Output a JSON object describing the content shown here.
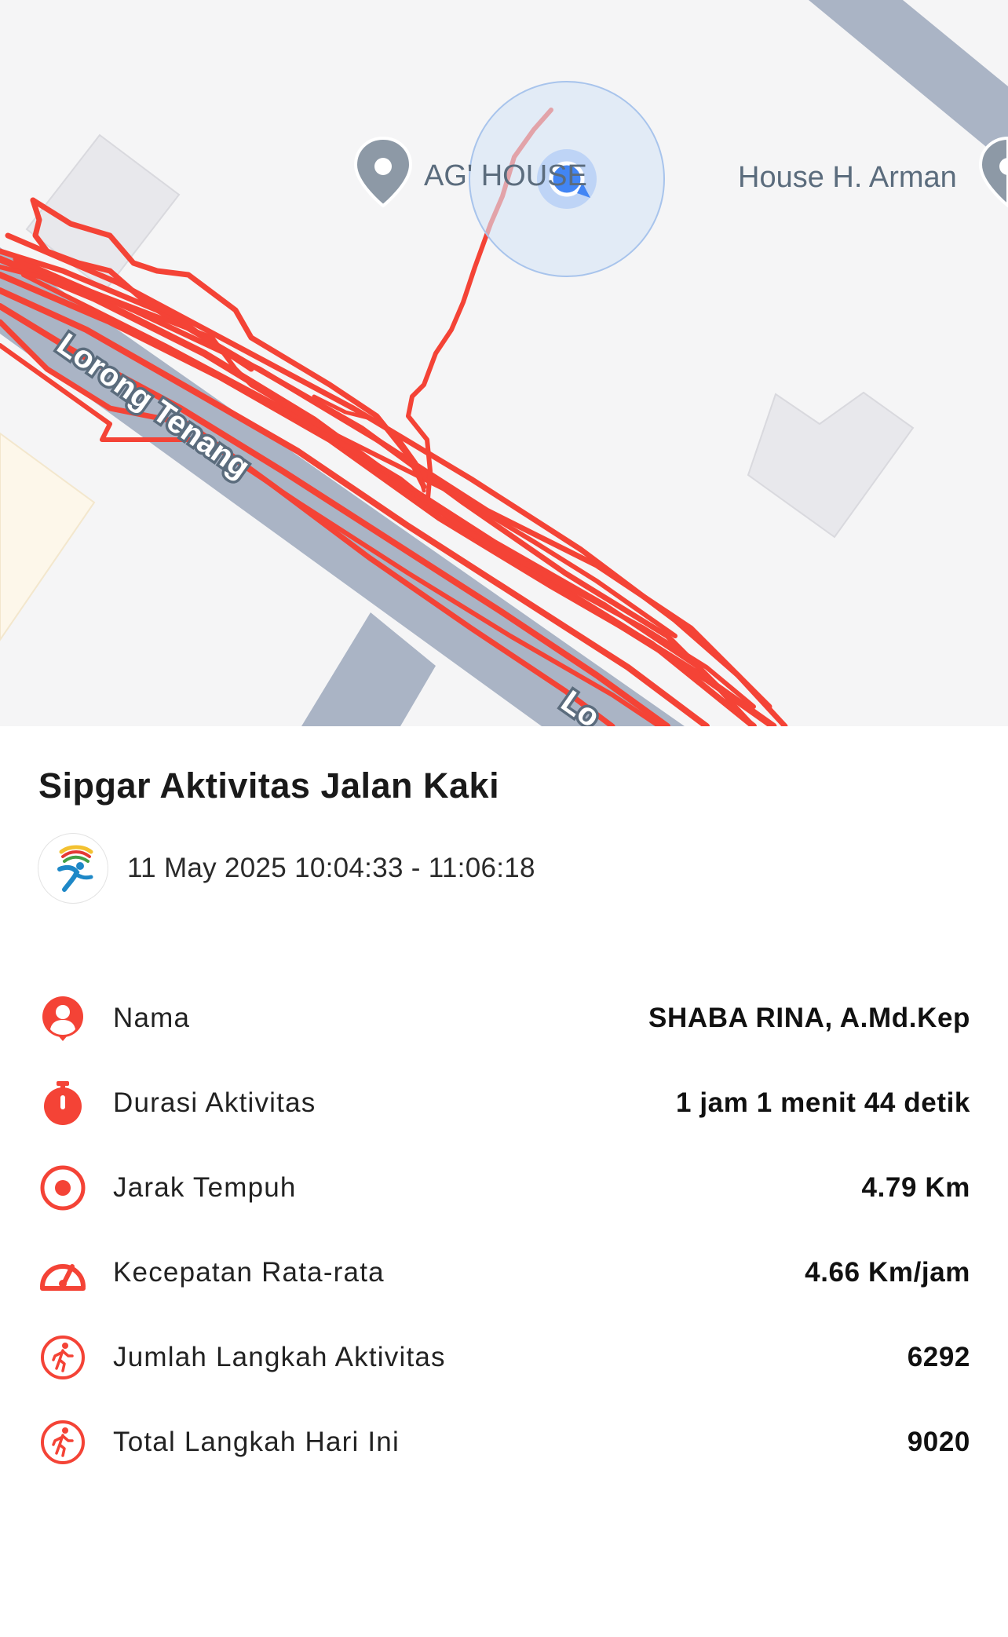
{
  "map": {
    "poi_1": "AG' HOUSE",
    "poi_2": "House H. Arman",
    "street_1": "Lorong Tenang",
    "street_2": "Lo",
    "track_color": "#f44336",
    "road_color": "#aab4c5",
    "location_dot_color": "#4285f4"
  },
  "activity": {
    "title": "Sipgar Aktivitas Jalan Kaki",
    "datetime": "11 May 2025 10:04:33 - 11:06:18",
    "app_logo_icon": "runner-logo-icon"
  },
  "stats": [
    {
      "icon": "person-icon",
      "label": "Nama",
      "value": "SHABA RINA, A.Md.Kep"
    },
    {
      "icon": "stopwatch-icon",
      "label": "Durasi Aktivitas",
      "value": "1 jam 1 menit 44 detik"
    },
    {
      "icon": "target-icon",
      "label": "Jarak Tempuh",
      "value": "4.79 Km"
    },
    {
      "icon": "speedometer-icon",
      "label": "Kecepatan Rata-rata",
      "value": "4.66 Km/jam"
    },
    {
      "icon": "walking-icon",
      "label": "Jumlah Langkah Aktivitas",
      "value": "6292"
    },
    {
      "icon": "walking-icon",
      "label": "Total Langkah Hari Ini",
      "value": "9020"
    }
  ],
  "colors": {
    "accent": "#f44336"
  }
}
